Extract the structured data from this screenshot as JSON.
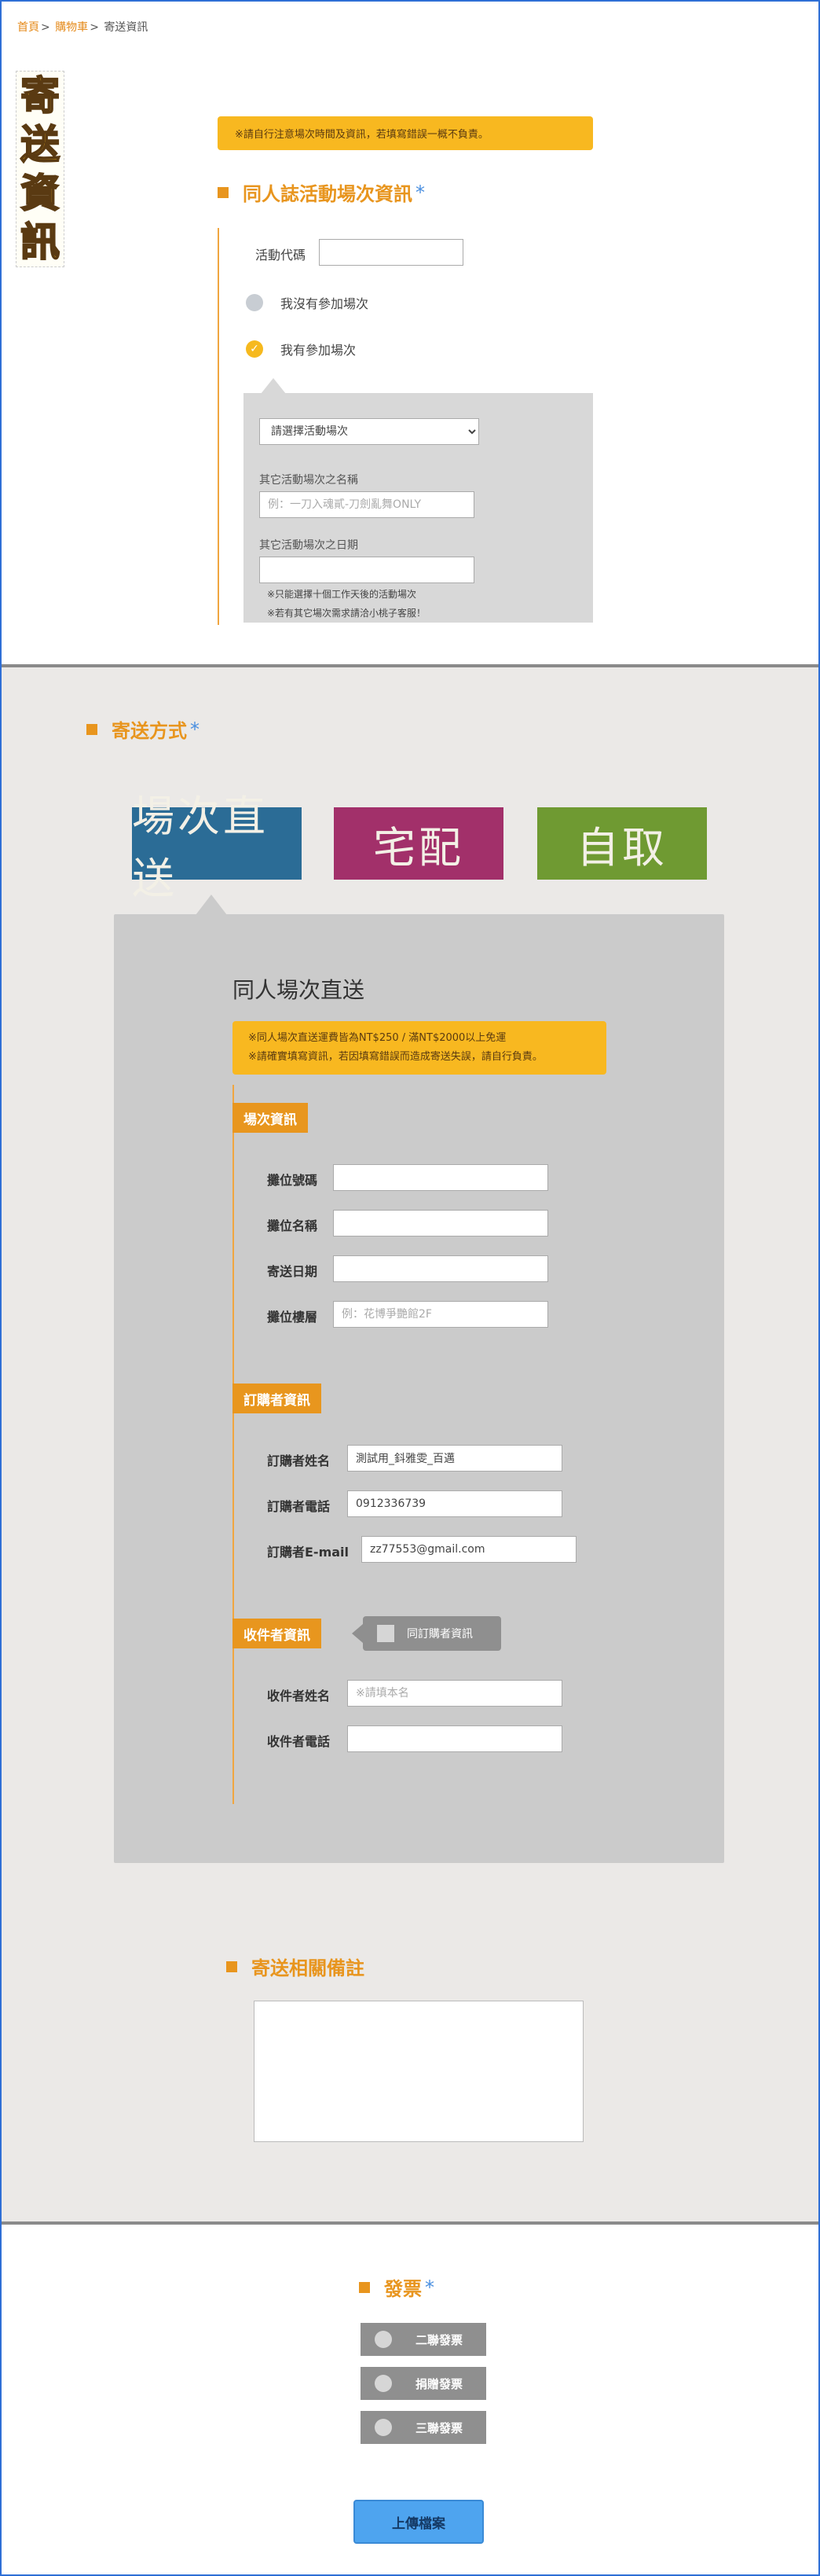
{
  "breadcrumb": {
    "home": "首頁",
    "cart": "購物車",
    "current": "寄送資訊",
    "sep": ">"
  },
  "vertical_title": [
    "寄",
    "送",
    "資",
    "訊"
  ],
  "top_notice": "※請自行注意場次時間及資訊，若填寫錯誤一概不負責。",
  "event_section": {
    "title": "同人誌活動場次資訊",
    "required": "*",
    "code_label": "活動代碼",
    "code_value": "",
    "radio_no": "我沒有參加場次",
    "radio_yes": "我有參加場次",
    "select_placeholder": "請選擇活動場次",
    "other_name_label": "其它活動場次之名稱",
    "other_name_placeholder": "例：一刀入魂貳-刀劍亂舞ONLY",
    "other_date_label": "其它活動場次之日期",
    "notes": [
      "※只能選擇十個工作天後的活動場次",
      "※若有其它場次需求請洽小桃子客服！"
    ]
  },
  "shipping": {
    "title": "寄送方式",
    "required": "*",
    "options": [
      {
        "label": "場次直送",
        "color": "#2b6c96"
      },
      {
        "label": "宅配",
        "color": "#a2306a"
      },
      {
        "label": "自取",
        "color": "#6f9a32"
      }
    ],
    "panel_title": "同人場次直送",
    "panel_notice": [
      "※同人場次直送運費皆為NT$250 / 滿NT$2000以上免運",
      "※請確實填寫資訊，若因填寫錯誤而造成寄送失誤，請自行負責。"
    ],
    "booth": {
      "tag": "場次資訊",
      "number_label": "攤位號碼",
      "number_value": "",
      "name_label": "攤位名稱",
      "name_value": "",
      "date_label": "寄送日期",
      "date_value": "",
      "floor_label": "攤位樓層",
      "floor_placeholder": "例：花博爭艷館2F"
    },
    "buyer": {
      "tag": "訂購者資訊",
      "name_label": "訂購者姓名",
      "name_value": "測試用_鈄雅雯_百邁",
      "phone_label": "訂購者電話",
      "phone_value": "0912336739",
      "email_label": "訂購者E-mail",
      "email_value": "zz77553@gmail.com"
    },
    "receiver": {
      "tag": "收件者資訊",
      "same_label": "同訂購者資訊",
      "name_label": "收件者姓名",
      "name_placeholder": "※請填本名",
      "phone_label": "收件者電話",
      "phone_value": ""
    }
  },
  "remarks": {
    "title": "寄送相關備註",
    "value": ""
  },
  "invoice": {
    "title": "發票",
    "required": "*",
    "options": [
      "二聯發票",
      "捐贈發票",
      "三聯發票"
    ]
  },
  "upload_button": "上傳檔案",
  "colors": {
    "accent": "#e8951e",
    "notice": "#f8b820",
    "star": "#4a8fe0",
    "frame": "#2f6fd6"
  }
}
